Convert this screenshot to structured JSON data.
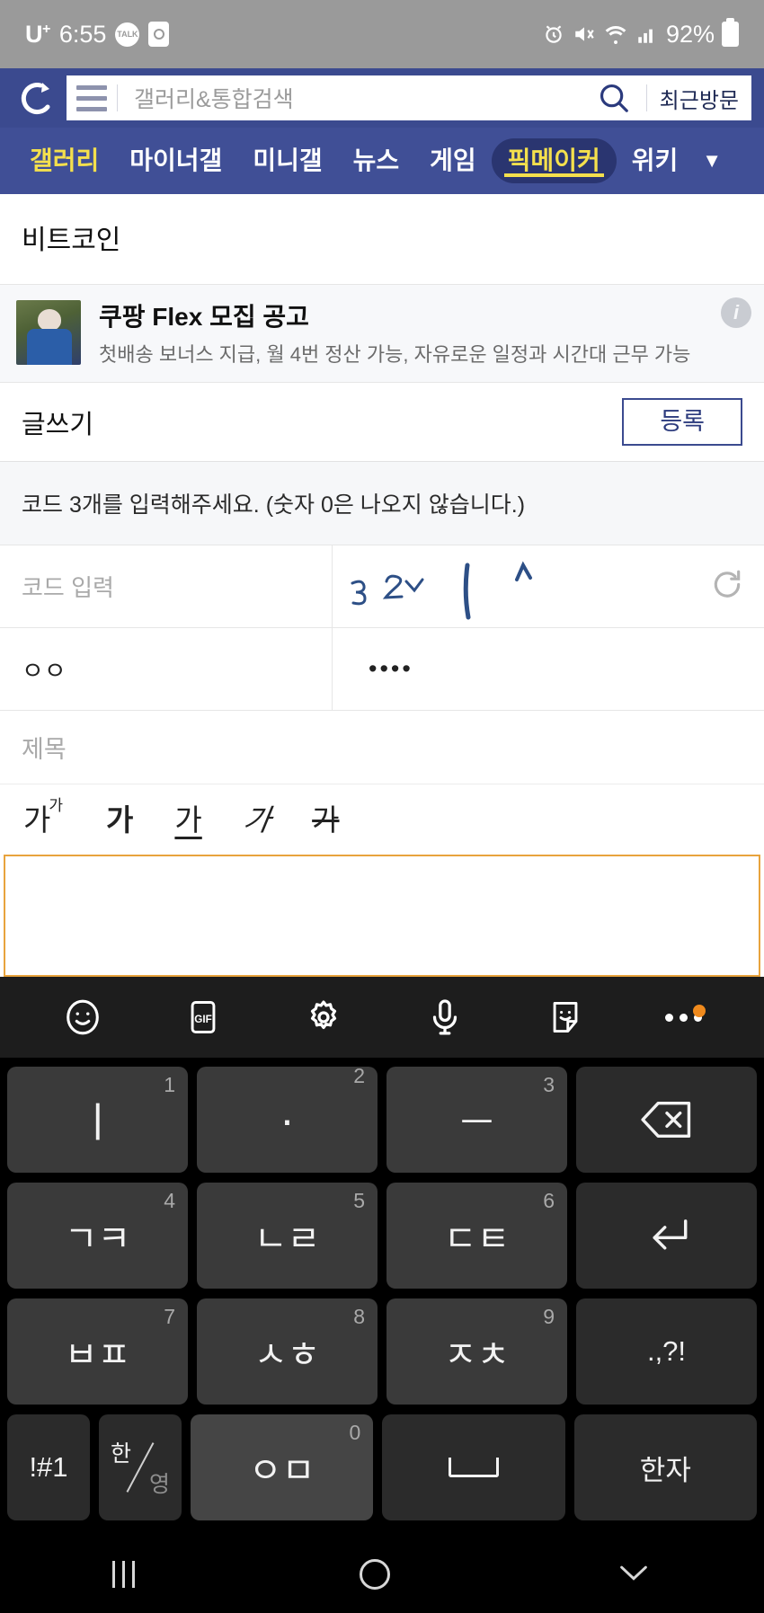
{
  "statusbar": {
    "carrier": "U",
    "carrier_sup": "+",
    "time": "6:55",
    "talk_icon": "kakaotalk-icon",
    "clock_icon": "clock-icon",
    "alarm_icon": "alarm-icon",
    "mute_icon": "vibrate-mute-icon",
    "wifi_icon": "wifi-icon",
    "signal_icon": "cellular-signal-icon",
    "battery_percent": "92%",
    "battery_icon": "battery-icon"
  },
  "header": {
    "logo": "DC",
    "menu_icon": "hamburger-menu-icon",
    "search_placeholder": "갤러리&통합검색",
    "search_icon": "search-icon",
    "recent_label": "최근방문"
  },
  "nav": {
    "items": [
      {
        "label": "갤러리",
        "state": "active"
      },
      {
        "label": "마이너갤",
        "state": "normal"
      },
      {
        "label": "미니갤",
        "state": "normal"
      },
      {
        "label": "뉴스",
        "state": "normal"
      },
      {
        "label": "게임",
        "state": "normal"
      },
      {
        "label": "픽메이커",
        "state": "pill"
      },
      {
        "label": "위키",
        "state": "normal"
      }
    ],
    "caret_icon": "chevron-down-icon",
    "caret": "▼"
  },
  "gallery": {
    "title": "비트코인"
  },
  "ad": {
    "title": "쿠팡 Flex 모집 공고",
    "subtitle": "첫배송 보너스 지급, 월 4번 정산 가능, 자유로운 일정과 시간대 근무 가능",
    "info_icon": "info-icon",
    "info_glyph": "i",
    "thumb_icon": "ad-thumbnail-image"
  },
  "write": {
    "title": "글쓰기",
    "submit_label": "등록"
  },
  "captcha": {
    "notice": "코드 3개를 입력해주세요. (숫자 0은 나오지 않습니다.)",
    "input_placeholder": "코드 입력",
    "refresh_icon": "refresh-icon",
    "image_icon": "captcha-image"
  },
  "author": {
    "nickname": "ㅇㅇ",
    "password_masked": "••••"
  },
  "subject": {
    "placeholder": "제목"
  },
  "format_toolbar": [
    {
      "name": "font-size-button",
      "glyph": "가",
      "sup": "가"
    },
    {
      "name": "bold-button",
      "glyph": "가"
    },
    {
      "name": "underline-button",
      "glyph": "가"
    },
    {
      "name": "italic-button",
      "glyph": "가"
    },
    {
      "name": "strikethrough-button",
      "glyph": "가"
    }
  ],
  "editor": {
    "content": ""
  },
  "keyboard_toolbar": [
    {
      "name": "emoji-icon"
    },
    {
      "name": "gif-icon",
      "label": "GIF"
    },
    {
      "name": "gear-icon"
    },
    {
      "name": "microphone-icon"
    },
    {
      "name": "sticker-icon"
    },
    {
      "name": "more-options-icon"
    }
  ],
  "keyboard": {
    "rows": [
      [
        {
          "label": "ㅣ",
          "num": "1",
          "style": "vbar",
          "name": "key-i"
        },
        {
          "label": "·",
          "num": "2",
          "style": "dotkey",
          "name": "key-dot"
        },
        {
          "label": "ㅡ",
          "num": "3",
          "style": "",
          "name": "key-eu"
        },
        {
          "label": "",
          "num": "",
          "style": "dark",
          "name": "backspace-key",
          "icon": "backspace-icon"
        }
      ],
      [
        {
          "label": "ㄱㅋ",
          "num": "4",
          "style": "",
          "name": "key-giyeok-kieuk"
        },
        {
          "label": "ㄴㄹ",
          "num": "5",
          "style": "",
          "name": "key-nieun-rieul"
        },
        {
          "label": "ㄷㅌ",
          "num": "6",
          "style": "",
          "name": "key-digeut-tieut"
        },
        {
          "label": "",
          "num": "",
          "style": "dark",
          "name": "enter-key",
          "icon": "enter-icon"
        }
      ],
      [
        {
          "label": "ㅂㅍ",
          "num": "7",
          "style": "",
          "name": "key-bieup-pieup"
        },
        {
          "label": "ㅅㅎ",
          "num": "8",
          "style": "",
          "name": "key-siot-hieut"
        },
        {
          "label": "ㅈㅊ",
          "num": "9",
          "style": "",
          "name": "key-jieut-chieut"
        },
        {
          "label": ".,?!",
          "num": "",
          "style": "dark small",
          "name": "punctuation-key"
        }
      ]
    ],
    "bottom_row": {
      "symbols_label": "!#1",
      "symbols_name": "symbols-key",
      "lang_top": "한",
      "lang_bottom": "영",
      "lang_name": "language-toggle-key",
      "ieung_label": "ㅇㅁ",
      "ieung_num": "0",
      "ieung_name": "key-ieung-mieum",
      "space_name": "space-key",
      "space_icon": "spacebar-icon",
      "hanja_label": "한자",
      "hanja_name": "hanja-key"
    }
  },
  "navbar": {
    "recents_icon": "recents-icon",
    "home_icon": "home-icon",
    "back_icon": "hide-keyboard-chevron-icon",
    "back_glyph": "⌄"
  }
}
